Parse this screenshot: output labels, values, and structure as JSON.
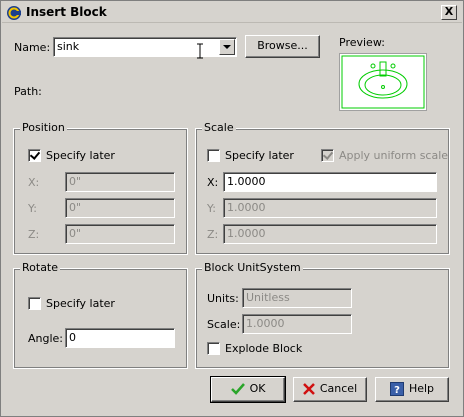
{
  "window": {
    "title": "Insert Block",
    "close_label": "X"
  },
  "top": {
    "name_label": "Name:",
    "name_value": "sink",
    "browse_label": "Browse...",
    "preview_label": "Preview:",
    "path_label": "Path:"
  },
  "position": {
    "title": "Position",
    "specify_later_label": "Specify later",
    "specify_later_checked": true,
    "x_label": "X:",
    "x_value": "0\"",
    "y_label": "Y:",
    "y_value": "0\"",
    "z_label": "Z:",
    "z_value": "0\""
  },
  "scale": {
    "title": "Scale",
    "specify_later_label": "Specify later",
    "specify_later_checked": false,
    "uniform_label": "Apply uniform scale",
    "uniform_checked": true,
    "x_label": "X:",
    "x_value": "1.0000",
    "y_label": "Y:",
    "y_value": "1.0000",
    "z_label": "Z:",
    "z_value": "1.0000"
  },
  "rotate": {
    "title": "Rotate",
    "specify_later_label": "Specify later",
    "specify_later_checked": false,
    "angle_label": "Angle:",
    "angle_value": "0"
  },
  "unitsystem": {
    "title": "Block UnitSystem",
    "units_label": "Units:",
    "units_value": "Unitless",
    "scale_label": "Scale:",
    "scale_value": "1.0000",
    "explode_label": "Explode Block",
    "explode_checked": false
  },
  "buttons": {
    "ok_label": "OK",
    "cancel_label": "Cancel",
    "help_label": "Help"
  },
  "colors": {
    "preview_stroke": "#00cc00",
    "ok_icon": "#2aa52a",
    "cancel_icon": "#d01010",
    "help_icon": "#3a5fa8"
  }
}
